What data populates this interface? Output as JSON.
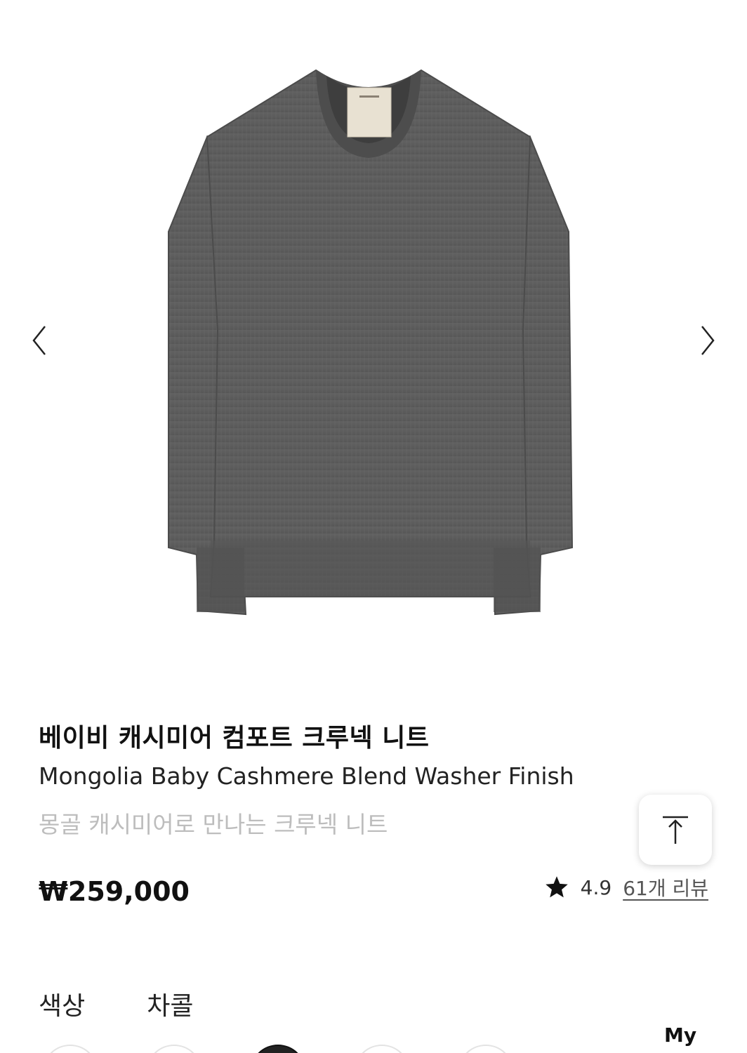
{
  "product": {
    "title_ko": "베이비 캐시미어 컴포트 크루넥 니트",
    "title_en": "Mongolia Baby Cashmere Blend Washer Finish",
    "subtitle": "몽골 캐시미어로 만나는 크루넥 니트",
    "price": "₩259,000",
    "rating": "4.9",
    "review_link": "61개 리뷰"
  },
  "options": {
    "color_label": "색상",
    "color_value": "차콜"
  },
  "nav": {
    "my_label": "My"
  },
  "swatches": [
    {
      "color": "#ffffff",
      "selected": false
    },
    {
      "color": "#ffffff",
      "selected": false
    },
    {
      "color": "#222222",
      "selected": true
    },
    {
      "color": "#ffffff",
      "selected": false
    },
    {
      "color": "#ffffff",
      "selected": false
    }
  ],
  "colors": {
    "sweater": "#5a5a5a",
    "sweater_dark": "#4a4a4a",
    "label_tag": "#e8e1d2",
    "subtitle_text": "#bdbdbd"
  },
  "icons": {
    "prev": "chevron-left-icon",
    "next": "chevron-right-icon",
    "star": "star-icon",
    "scroll_top": "arrow-up-to-top-icon"
  }
}
